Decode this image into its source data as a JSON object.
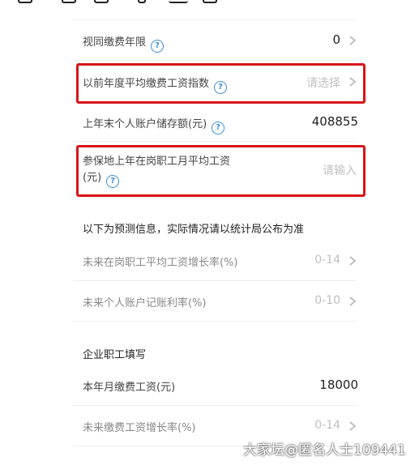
{
  "rows": {
    "contribution_years": {
      "label": "视同缴费年限",
      "value": "0"
    },
    "prior_wage_index": {
      "label": "以前年度平均缴费工资指数",
      "placeholder": "请选择"
    },
    "account_balance": {
      "label": "上年末个人账户储存额(元)",
      "value": "408855"
    },
    "local_avg_wage": {
      "label_line1": "参保地上年在岗职工月平均工资",
      "label_line2": "(元)",
      "placeholder": "请输入"
    }
  },
  "forecast": {
    "heading": "以下为预测信息，实际情况请以统计局公布为准",
    "wage_growth": {
      "label": "未来在岗职工平均工资增长率(%)",
      "placeholder": "0-14"
    },
    "account_rate": {
      "label": "未来个人账户记账利率(%)",
      "placeholder": "0-10"
    }
  },
  "enterprise": {
    "heading": "企业职工填写",
    "monthly_wage": {
      "label": "本年月缴费工资(元)",
      "value": "18000"
    },
    "future_wage_growth": {
      "label": "未来缴费工资增长率(%)",
      "placeholder": "0-14"
    }
  },
  "watermark": "大家坛@匿名人士109441",
  "help_glyph": "?",
  "icons": [
    "help-circle-icon",
    "chevron-right-icon"
  ],
  "colors": {
    "highlight": "#d8141a",
    "help": "#3a8fd8",
    "placeholder": "#c0c0c0"
  }
}
